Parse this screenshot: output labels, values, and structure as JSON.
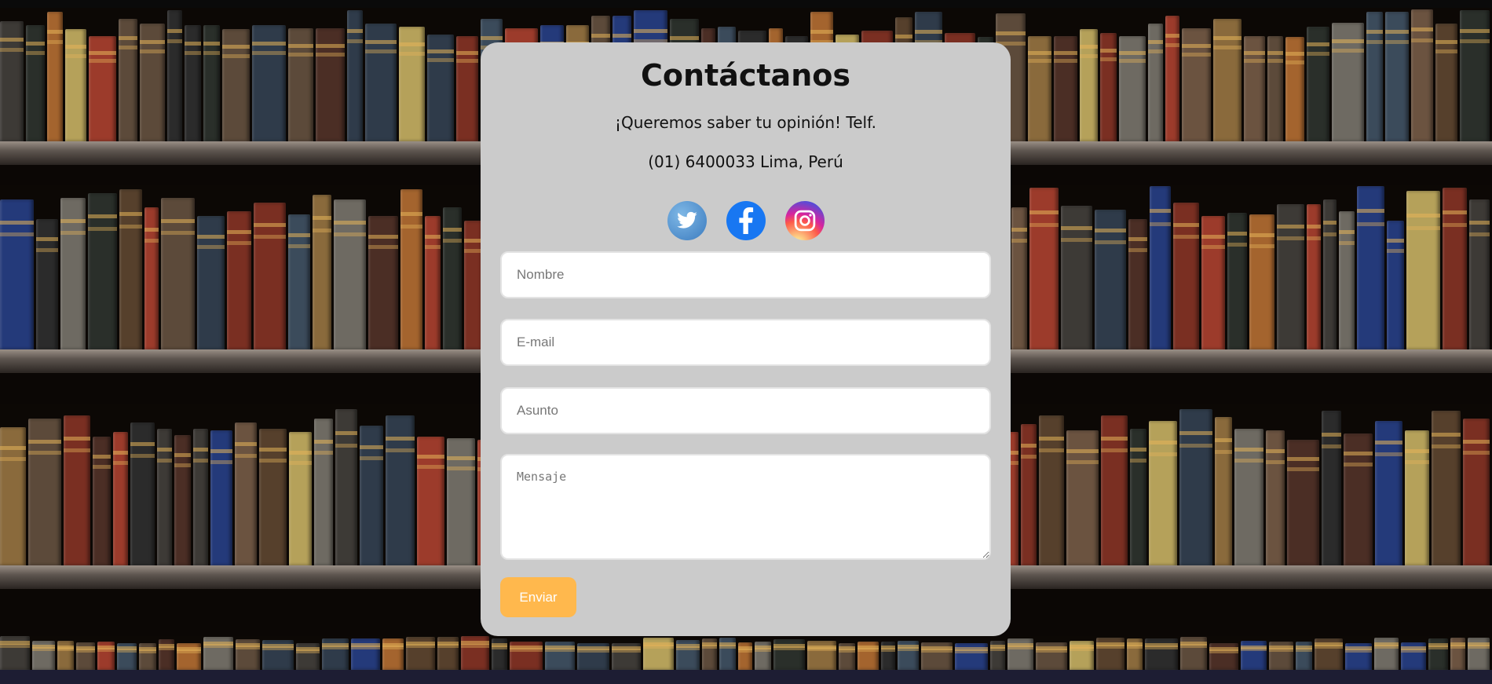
{
  "contact": {
    "title": "Contáctanos",
    "subtitle": "¡Queremos saber tu opinión! Telf.",
    "phone_line": "(01) 6400033 Lima, Perú"
  },
  "socials": [
    {
      "name": "twitter",
      "icon": "twitter-icon",
      "color": "#4a8fd1"
    },
    {
      "name": "facebook",
      "icon": "facebook-icon",
      "color": "#1877f2"
    },
    {
      "name": "instagram",
      "icon": "instagram-icon",
      "color": "#d6249f"
    }
  ],
  "form": {
    "name_placeholder": "Nombre",
    "email_placeholder": "E-mail",
    "subject_placeholder": "Asunto",
    "message_placeholder": "Mensaje",
    "submit_label": "Enviar"
  },
  "colors": {
    "card_bg": "#cbcbcb",
    "button_bg": "#ffb84d",
    "button_text": "#ffffff"
  }
}
